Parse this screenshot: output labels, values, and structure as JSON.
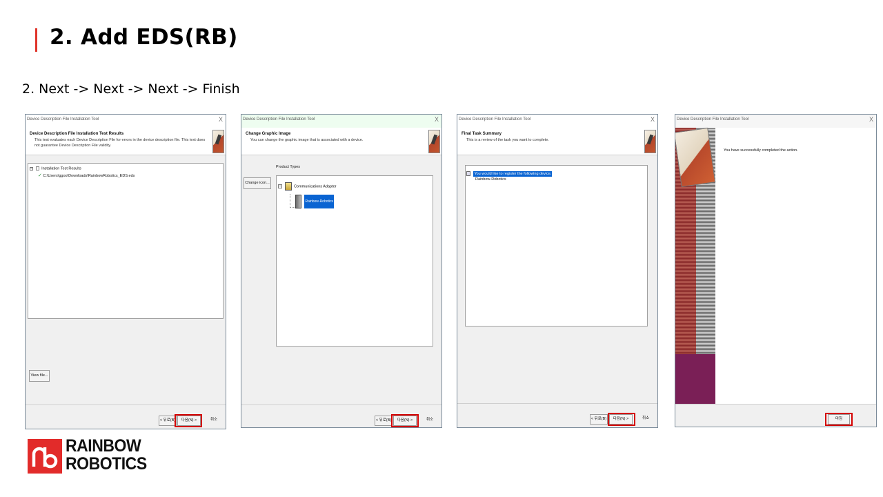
{
  "slide": {
    "title": "2. Add EDS(RB)",
    "instruction": "2. Next -> Next -> Next -> Finish"
  },
  "colors": {
    "accent": "#e0352b",
    "highlight": "#d40000",
    "selection": "#0a64d2",
    "finish_band": "#7a1f56"
  },
  "wizard_title": "Device Description File Installation Tool",
  "close_glyph": "X",
  "panel1": {
    "header_title": "Device Description File Installation Test Results",
    "header_desc": "This test evaluates each Device Description File for errors in the device description file. This text does not guarantee Device Description File validity.",
    "tree_root": "Installation Test Results",
    "tree_item": "C:\\Users\\ggoo\\Downloads\\RainbowRobotics_EDS.eds",
    "view_file": "View file...",
    "back": "< 뒤로(B)",
    "next": "다음(N) >",
    "cancel": "취소"
  },
  "panel2": {
    "header_title": "Change Graphic Image",
    "header_desc": "You can change the graphic image that is associated with a device.",
    "product_types_label": "Product Types",
    "change_icon": "Change icon...",
    "tree_root": "Communications Adapter",
    "tree_item": "Rainbow-Robotics",
    "back": "< 뒤로(B)",
    "next": "다음(N) >",
    "cancel": "취소"
  },
  "panel3": {
    "header_title": "Final Task Summary",
    "header_desc": "This is a review of the task you want to complete.",
    "summary_line": "You would like to register the following device.",
    "summary_item": "Rainbow-Robotics",
    "back": "< 뒤로(B)",
    "next": "다음(N) >",
    "cancel": "취소"
  },
  "panel4": {
    "message": "You have successfully completed the action.",
    "finish": "마침"
  },
  "logo": {
    "line1": "RAINBOW",
    "line2": "ROBOTICS"
  }
}
